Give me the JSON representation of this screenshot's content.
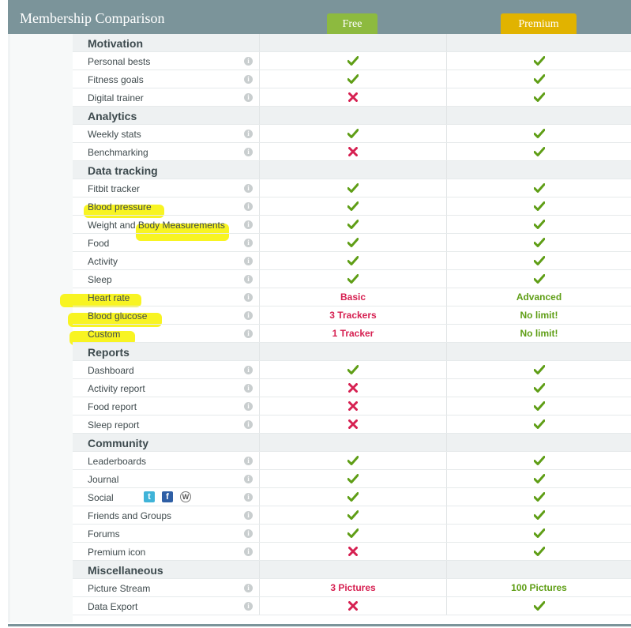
{
  "header": {
    "title": "Membership Comparison",
    "plans": {
      "free": "Free",
      "premium": "Premium"
    }
  },
  "info_glyph": "i",
  "social_glyphs": {
    "twitter": "t",
    "facebook": "f",
    "wordpress": "W"
  },
  "sections": [
    {
      "name": "Motivation",
      "rows": [
        {
          "label": "Personal bests",
          "free": "check",
          "premium": "check"
        },
        {
          "label": "Fitness goals",
          "free": "check",
          "premium": "check"
        },
        {
          "label": "Digital trainer",
          "free": "cross",
          "premium": "check"
        }
      ]
    },
    {
      "name": "Analytics",
      "rows": [
        {
          "label": "Weekly stats",
          "free": "check",
          "premium": "check"
        },
        {
          "label": "Benchmarking",
          "free": "cross",
          "premium": "check"
        }
      ]
    },
    {
      "name": "Data tracking",
      "rows": [
        {
          "label": "Fitbit tracker",
          "free": "check",
          "premium": "check"
        },
        {
          "label": "Blood pressure",
          "free": "check",
          "premium": "check",
          "highlight": true
        },
        {
          "label": "Weight and Body Measurements",
          "free": "check",
          "premium": "check"
        },
        {
          "label": "Food",
          "free": "check",
          "premium": "check"
        },
        {
          "label": "Activity",
          "free": "check",
          "premium": "check"
        },
        {
          "label": "Sleep",
          "free": "check",
          "premium": "check"
        },
        {
          "label": "Heart rate",
          "free": "Basic",
          "premium": "Advanced",
          "highlight": true
        },
        {
          "label": "Blood glucose",
          "free": "3 Trackers",
          "premium": "No limit!",
          "highlight": true
        },
        {
          "label": "Custom",
          "free": "1 Tracker",
          "premium": "No limit!",
          "highlight": true
        }
      ]
    },
    {
      "name": "Reports",
      "rows": [
        {
          "label": "Dashboard",
          "free": "check",
          "premium": "check"
        },
        {
          "label": "Activity report",
          "free": "cross",
          "premium": "check"
        },
        {
          "label": "Food report",
          "free": "cross",
          "premium": "check"
        },
        {
          "label": "Sleep report",
          "free": "cross",
          "premium": "check"
        }
      ]
    },
    {
      "name": "Community",
      "rows": [
        {
          "label": "Leaderboards",
          "free": "check",
          "premium": "check"
        },
        {
          "label": "Journal",
          "free": "check",
          "premium": "check"
        },
        {
          "label": "Social",
          "free": "check",
          "premium": "check",
          "social": true
        },
        {
          "label": "Friends and Groups",
          "free": "check",
          "premium": "check"
        },
        {
          "label": "Forums",
          "free": "check",
          "premium": "check"
        },
        {
          "label": "Premium icon",
          "free": "cross",
          "premium": "check"
        }
      ]
    },
    {
      "name": "Miscellaneous",
      "rows": [
        {
          "label": "Picture Stream",
          "free": "3 Pictures",
          "premium": "100 Pictures"
        },
        {
          "label": "Data Export",
          "free": "cross",
          "premium": "check"
        }
      ]
    }
  ],
  "colors": {
    "header_bg": "#7b949a",
    "free_badge": "#8dba3f",
    "premium_badge": "#e1b300",
    "check": "#5f9e16",
    "cross": "#d62051",
    "highlighter": "#f7f30a"
  }
}
